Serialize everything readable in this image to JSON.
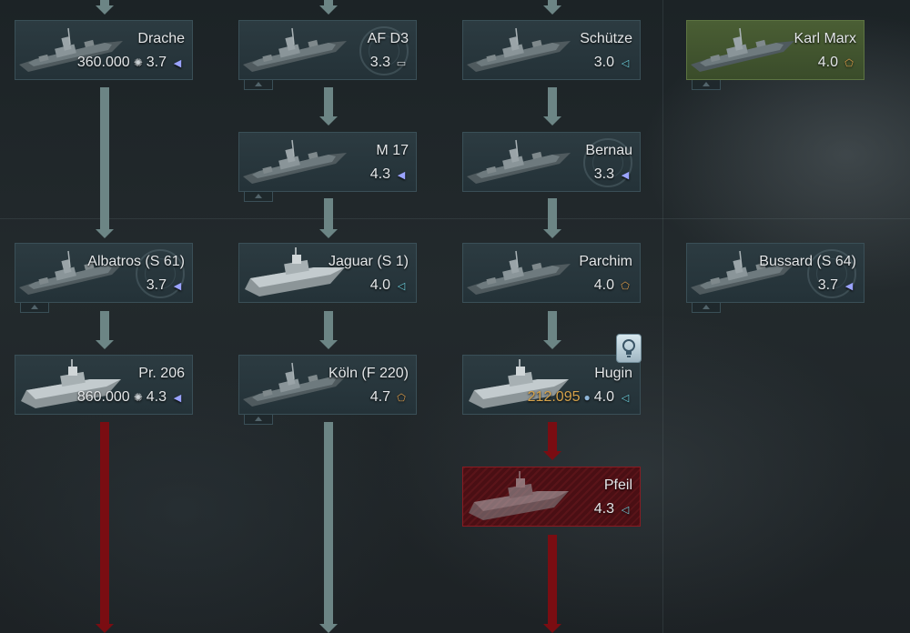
{
  "colors": {
    "card_bg": "#2b3a40",
    "card_premium_bg": "#4a5e34",
    "card_locked_bg": "#5a1419",
    "connector_gray": "#6c8585",
    "connector_red": "#7a0d12",
    "gold_price": "#d5a24a"
  },
  "vehicles": {
    "drache": {
      "name": "Drache",
      "price": "360.000",
      "br": "3.7",
      "role_icon": "triangle-blue"
    },
    "af_d3": {
      "name": "AF D3",
      "price": "",
      "br": "3.3",
      "role_icon": "rectangle-white"
    },
    "schutze": {
      "name": "Schütze",
      "price": "",
      "br": "3.0",
      "role_icon": "triangle-cyan"
    },
    "karl_marx": {
      "name": "Karl Marx",
      "price": "",
      "br": "4.0",
      "role_icon": "pentagon-orange"
    },
    "m17": {
      "name": "M 17",
      "price": "",
      "br": "4.3",
      "role_icon": "triangle-blue"
    },
    "bernau": {
      "name": "Bernau",
      "price": "",
      "br": "3.3",
      "role_icon": "triangle-blue"
    },
    "albatros": {
      "name": "Albatros (S 61)",
      "price": "",
      "br": "3.7",
      "role_icon": "triangle-blue"
    },
    "jaguar": {
      "name": "Jaguar (S 1)",
      "price": "",
      "br": "4.0",
      "role_icon": "triangle-cyan"
    },
    "parchim": {
      "name": "Parchim",
      "price": "",
      "br": "4.0",
      "role_icon": "pentagon-orange"
    },
    "bussard": {
      "name": "Bussard (S 64)",
      "price": "",
      "br": "3.7",
      "role_icon": "triangle-blue"
    },
    "pr206": {
      "name": "Pr. 206",
      "price": "860.000",
      "br": "4.3",
      "role_icon": "triangle-blue"
    },
    "koln": {
      "name": "Köln (F 220)",
      "price": "",
      "br": "4.7",
      "role_icon": "pentagon-orange"
    },
    "hugin": {
      "name": "Hugin",
      "price": "212.095",
      "br": "4.0",
      "role_icon": "triangle-cyan"
    },
    "pfeil": {
      "name": "Pfeil",
      "price": "",
      "br": "4.3",
      "role_icon": "triangle-cyan"
    }
  }
}
